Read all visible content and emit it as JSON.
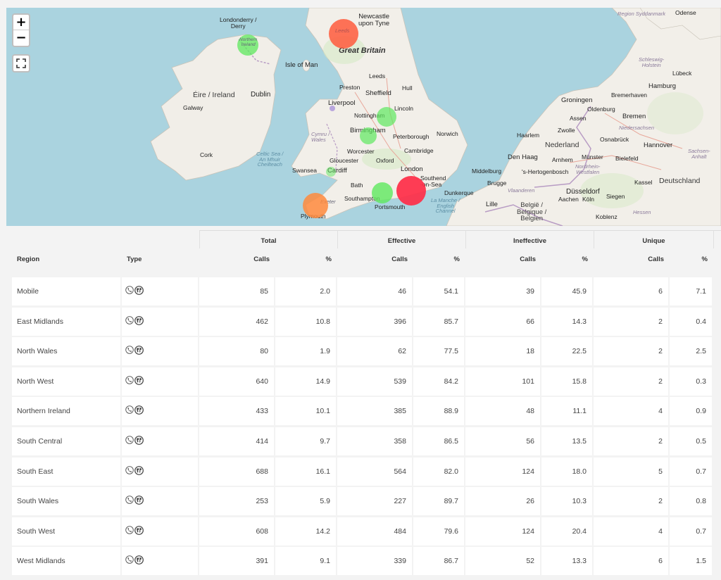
{
  "map": {
    "zoom_in_label": "+",
    "zoom_out_label": "−",
    "labels": {
      "londonderry": "Londonderry /\nDerry",
      "newcastle": "Newcastle\nupon Tyne",
      "great_britain": "Great Britain",
      "northern_ireland": "Northern\nIreland",
      "isle_of_man": "Isle of Man",
      "leeds": "Leeds",
      "preston": "Preston",
      "hull": "Hull",
      "eire": "Éire / Ireland",
      "dublin": "Dublin",
      "galway": "Galway",
      "liverpool": "Liverpool",
      "sheffield": "Sheffield",
      "lincoln": "Lincoln",
      "nottingham": "Nottingham",
      "birmingham": "Birmingham",
      "peterborough": "Peterborough",
      "norwich": "Norwich",
      "cymru": "Cymru /\nWales",
      "worcester": "Worcester",
      "cambridge": "Cambridge",
      "cork": "Cork",
      "celtic_sea": "Celtic Sea /\nAn Mhuir\nCheilteach",
      "gloucester": "Gloucester",
      "oxford": "Oxford",
      "swansea": "Swansea",
      "cardiff": "Cardiff",
      "london": "London",
      "southend": "Southend\n-on-Sea",
      "bath": "Bath",
      "southampton": "Southampton",
      "portsmouth": "Portsmouth",
      "exeter": "Exeter",
      "plymouth": "Plymouth",
      "dunkerque": "Dunkerque",
      "english_channel": "La Manche /\nEnglish\nChannel",
      "lille": "Lille",
      "belgique": "België /\nBelgique /\nBelgien",
      "brugge": "Brugge",
      "vlaanderen": "Vlaanderen",
      "middelburg": "Middelburg",
      "den_haag": "Den Haag",
      "shertogenbosch": "'s-Hertogenbosch",
      "arnhem": "Arnhem",
      "haarlem": "Haarlem",
      "zwolle": "Zwolle",
      "nederland": "Nederland",
      "groningen": "Groningen",
      "assen": "Assen",
      "oldenburg": "Oldenburg",
      "bremerhaven": "Bremerhaven",
      "bremen": "Bremen",
      "hamburg": "Hamburg",
      "lubeck": "Lübeck",
      "schleswig": "Schleswig-\nHolstein",
      "niedersachsen": "Niedersachsen",
      "osnabruck": "Osnabrück",
      "munster": "Münster",
      "bielefeld": "Bielefeld",
      "hannover": "Hannover",
      "nordrhein": "Nordrhein-\nWestfalen",
      "kassel": "Kassel",
      "deutschland": "Deutschland",
      "dusseldorf": "Düsseldorf",
      "aachen": "Aachen",
      "koln": "Köln",
      "siegen": "Siegen",
      "hessen": "Hessen",
      "koblenz": "Koblenz",
      "sachsen_anhalt": "Sachsen-\nAnhalt",
      "odense": "Odense",
      "syddanmark": "Region Syddanmark",
      "leeds_bubble": "Leeds"
    },
    "bubble_colors": {
      "red": "#ff2d46",
      "orange_red": "#ff5a3c",
      "orange": "#ff8a3d",
      "green": "#5ee85e"
    }
  },
  "table": {
    "groups": [
      "Total",
      "Effective",
      "Ineffective",
      "Unique"
    ],
    "columns": {
      "region": "Region",
      "type": "Type",
      "calls": "Calls",
      "pct": "%"
    },
    "type_icons": [
      "phone-icon",
      "globe-icon"
    ],
    "rows": [
      {
        "region": "Mobile",
        "total_calls": "85",
        "total_pct": "2.0",
        "eff_calls": "46",
        "eff_pct": "54.1",
        "ineff_calls": "39",
        "ineff_pct": "45.9",
        "uniq_calls": "6",
        "uniq_pct": "7.1"
      },
      {
        "region": "East Midlands",
        "total_calls": "462",
        "total_pct": "10.8",
        "eff_calls": "396",
        "eff_pct": "85.7",
        "ineff_calls": "66",
        "ineff_pct": "14.3",
        "uniq_calls": "2",
        "uniq_pct": "0.4"
      },
      {
        "region": "North Wales",
        "total_calls": "80",
        "total_pct": "1.9",
        "eff_calls": "62",
        "eff_pct": "77.5",
        "ineff_calls": "18",
        "ineff_pct": "22.5",
        "uniq_calls": "2",
        "uniq_pct": "2.5"
      },
      {
        "region": "North West",
        "total_calls": "640",
        "total_pct": "14.9",
        "eff_calls": "539",
        "eff_pct": "84.2",
        "ineff_calls": "101",
        "ineff_pct": "15.8",
        "uniq_calls": "2",
        "uniq_pct": "0.3"
      },
      {
        "region": "Northern Ireland",
        "total_calls": "433",
        "total_pct": "10.1",
        "eff_calls": "385",
        "eff_pct": "88.9",
        "ineff_calls": "48",
        "ineff_pct": "11.1",
        "uniq_calls": "4",
        "uniq_pct": "0.9"
      },
      {
        "region": "South Central",
        "total_calls": "414",
        "total_pct": "9.7",
        "eff_calls": "358",
        "eff_pct": "86.5",
        "ineff_calls": "56",
        "ineff_pct": "13.5",
        "uniq_calls": "2",
        "uniq_pct": "0.5"
      },
      {
        "region": "South East",
        "total_calls": "688",
        "total_pct": "16.1",
        "eff_calls": "564",
        "eff_pct": "82.0",
        "ineff_calls": "124",
        "ineff_pct": "18.0",
        "uniq_calls": "5",
        "uniq_pct": "0.7"
      },
      {
        "region": "South Wales",
        "total_calls": "253",
        "total_pct": "5.9",
        "eff_calls": "227",
        "eff_pct": "89.7",
        "ineff_calls": "26",
        "ineff_pct": "10.3",
        "uniq_calls": "2",
        "uniq_pct": "0.8"
      },
      {
        "region": "South West",
        "total_calls": "608",
        "total_pct": "14.2",
        "eff_calls": "484",
        "eff_pct": "79.6",
        "ineff_calls": "124",
        "ineff_pct": "20.4",
        "uniq_calls": "4",
        "uniq_pct": "0.7"
      },
      {
        "region": "West Midlands",
        "total_calls": "391",
        "total_pct": "9.1",
        "eff_calls": "339",
        "eff_pct": "86.7",
        "ineff_calls": "52",
        "ineff_pct": "13.3",
        "uniq_calls": "6",
        "uniq_pct": "1.5"
      }
    ]
  }
}
